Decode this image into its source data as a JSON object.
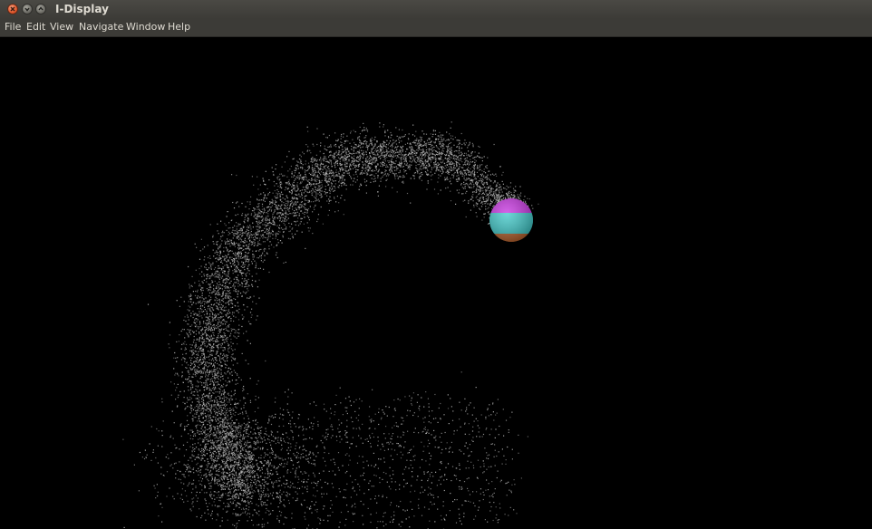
{
  "window": {
    "title": "I-Display",
    "controls": {
      "close": "close-icon",
      "minimize": "minimize-icon",
      "maximize": "maximize-icon"
    }
  },
  "menubar": {
    "items": [
      "File",
      "Edit",
      "View",
      "Navigate",
      "Window",
      "Help"
    ]
  },
  "viewport": {
    "background": "#000000",
    "point_color": "#b4b4b4",
    "sphere_colors": {
      "top": "#c630e0",
      "middle": "#3cc8c8",
      "bottom": "#b8602a"
    }
  }
}
